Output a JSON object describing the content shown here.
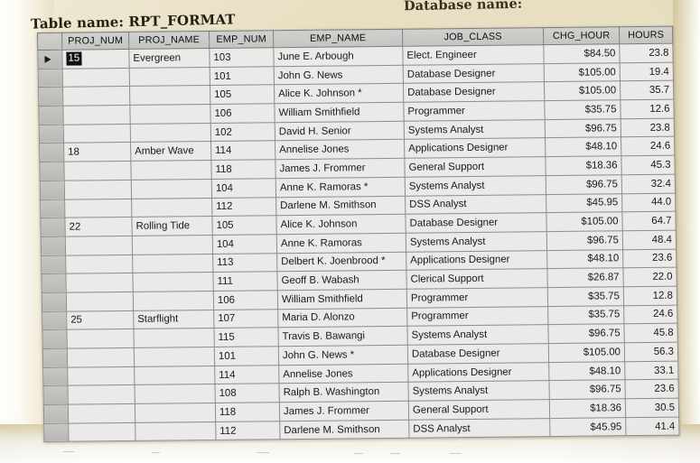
{
  "captions": {
    "database_name": "Database name:",
    "table_name": "Table name: RPT_FORMAT"
  },
  "datasheet": {
    "selected_row_index": 0,
    "selected_cell_value": "15",
    "row_selector_icon": "play-triangle-icon",
    "columns": [
      {
        "key": "proj_num",
        "label": "PROJ_NUM"
      },
      {
        "key": "proj_name",
        "label": "PROJ_NAME"
      },
      {
        "key": "emp_num",
        "label": "EMP_NUM"
      },
      {
        "key": "emp_name",
        "label": "EMP_NAME"
      },
      {
        "key": "job_class",
        "label": "JOB_CLASS"
      },
      {
        "key": "chg_hour",
        "label": "CHG_HOUR"
      },
      {
        "key": "hours",
        "label": "HOURS"
      }
    ],
    "rows": [
      {
        "proj_num": "15",
        "proj_name": "Evergreen",
        "emp_num": "103",
        "emp_name": "June E. Arbough",
        "job_class": "Elect. Engineer",
        "chg_hour": "$84.50",
        "hours": "23.8"
      },
      {
        "proj_num": "",
        "proj_name": "",
        "emp_num": "101",
        "emp_name": "John G. News",
        "job_class": "Database Designer",
        "chg_hour": "$105.00",
        "hours": "19.4"
      },
      {
        "proj_num": "",
        "proj_name": "",
        "emp_num": "105",
        "emp_name": "Alice K. Johnson *",
        "job_class": "Database Designer",
        "chg_hour": "$105.00",
        "hours": "35.7"
      },
      {
        "proj_num": "",
        "proj_name": "",
        "emp_num": "106",
        "emp_name": "William Smithfield",
        "job_class": "Programmer",
        "chg_hour": "$35.75",
        "hours": "12.6"
      },
      {
        "proj_num": "",
        "proj_name": "",
        "emp_num": "102",
        "emp_name": "David H. Senior",
        "job_class": "Systems Analyst",
        "chg_hour": "$96.75",
        "hours": "23.8"
      },
      {
        "proj_num": "18",
        "proj_name": "Amber Wave",
        "emp_num": "114",
        "emp_name": "Annelise Jones",
        "job_class": "Applications Designer",
        "chg_hour": "$48.10",
        "hours": "24.6"
      },
      {
        "proj_num": "",
        "proj_name": "",
        "emp_num": "118",
        "emp_name": "James J. Frommer",
        "job_class": "General Support",
        "chg_hour": "$18.36",
        "hours": "45.3"
      },
      {
        "proj_num": "",
        "proj_name": "",
        "emp_num": "104",
        "emp_name": "Anne K. Ramoras *",
        "job_class": "Systems Analyst",
        "chg_hour": "$96.75",
        "hours": "32.4"
      },
      {
        "proj_num": "",
        "proj_name": "",
        "emp_num": "112",
        "emp_name": "Darlene M. Smithson",
        "job_class": "DSS Analyst",
        "chg_hour": "$45.95",
        "hours": "44.0"
      },
      {
        "proj_num": "22",
        "proj_name": "Rolling Tide",
        "emp_num": "105",
        "emp_name": "Alice K. Johnson",
        "job_class": "Database Designer",
        "chg_hour": "$105.00",
        "hours": "64.7"
      },
      {
        "proj_num": "",
        "proj_name": "",
        "emp_num": "104",
        "emp_name": "Anne K. Ramoras",
        "job_class": "Systems Analyst",
        "chg_hour": "$96.75",
        "hours": "48.4"
      },
      {
        "proj_num": "",
        "proj_name": "",
        "emp_num": "113",
        "emp_name": "Delbert K. Joenbrood *",
        "job_class": "Applications Designer",
        "chg_hour": "$48.10",
        "hours": "23.6"
      },
      {
        "proj_num": "",
        "proj_name": "",
        "emp_num": "111",
        "emp_name": "Geoff B. Wabash",
        "job_class": "Clerical Support",
        "chg_hour": "$26.87",
        "hours": "22.0"
      },
      {
        "proj_num": "",
        "proj_name": "",
        "emp_num": "106",
        "emp_name": "William Smithfield",
        "job_class": "Programmer",
        "chg_hour": "$35.75",
        "hours": "12.8"
      },
      {
        "proj_num": "25",
        "proj_name": "Starflight",
        "emp_num": "107",
        "emp_name": "Maria D. Alonzo",
        "job_class": "Programmer",
        "chg_hour": "$35.75",
        "hours": "24.6"
      },
      {
        "proj_num": "",
        "proj_name": "",
        "emp_num": "115",
        "emp_name": "Travis B. Bawangi",
        "job_class": "Systems Analyst",
        "chg_hour": "$96.75",
        "hours": "45.8"
      },
      {
        "proj_num": "",
        "proj_name": "",
        "emp_num": "101",
        "emp_name": "John G. News *",
        "job_class": "Database Designer",
        "chg_hour": "$105.00",
        "hours": "56.3"
      },
      {
        "proj_num": "",
        "proj_name": "",
        "emp_num": "114",
        "emp_name": "Annelise Jones",
        "job_class": "Applications Designer",
        "chg_hour": "$48.10",
        "hours": "33.1"
      },
      {
        "proj_num": "",
        "proj_name": "",
        "emp_num": "108",
        "emp_name": "Ralph B. Washington",
        "job_class": "Systems Analyst",
        "chg_hour": "$96.75",
        "hours": "23.6"
      },
      {
        "proj_num": "",
        "proj_name": "",
        "emp_num": "118",
        "emp_name": "James J. Frommer",
        "job_class": "General Support",
        "chg_hour": "$18.36",
        "hours": "30.5"
      },
      {
        "proj_num": "",
        "proj_name": "",
        "emp_num": "112",
        "emp_name": "Darlene M. Smithson",
        "job_class": "DSS Analyst",
        "chg_hour": "$45.95",
        "hours": "41.4"
      }
    ]
  },
  "colors": {
    "page": "#e4dab9",
    "grid_header": "#c7c7c2",
    "grid_cell": "#e9e8e4",
    "grid_line": "#8d8d8d",
    "selected_cell_bg": "#111111",
    "selected_cell_fg": "#ffffff"
  }
}
